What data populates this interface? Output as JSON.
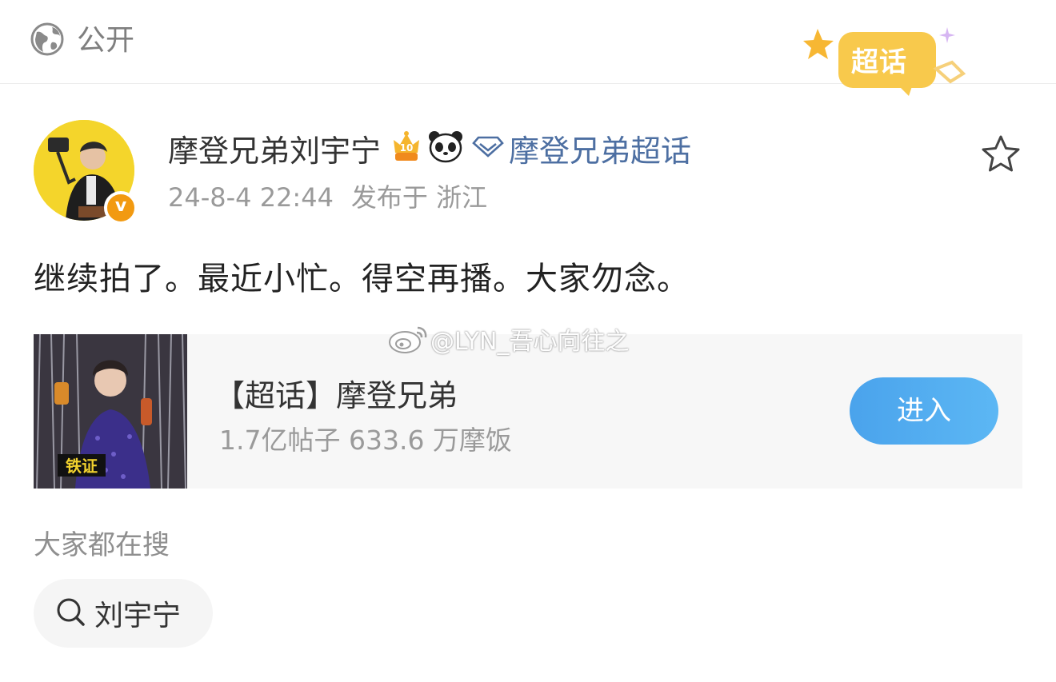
{
  "visibility": {
    "label": "公开",
    "icon": "globe-icon"
  },
  "super_badge": {
    "text": "超话"
  },
  "post": {
    "username": "摩登兄弟刘宇宁",
    "topic_link": "摩登兄弟超话",
    "timestamp": "24-8-4 22:44",
    "location": "发布于 浙江",
    "content": "继续拍了。最近小忙。得空再播。大家勿念。",
    "verified_badge": "v"
  },
  "topic_card": {
    "title": "【超话】摩登兄弟",
    "stats": "1.7亿帖子 633.6 万摩饭",
    "enter_label": "进入"
  },
  "watermark": {
    "text": "@LYN_吾心向往之"
  },
  "search": {
    "header": "大家都在搜",
    "chips": [
      {
        "label": "刘宇宁"
      }
    ]
  },
  "colors": {
    "link": "#4d6fa2",
    "button": "#4aa3ec",
    "badge": "#f29a11"
  }
}
